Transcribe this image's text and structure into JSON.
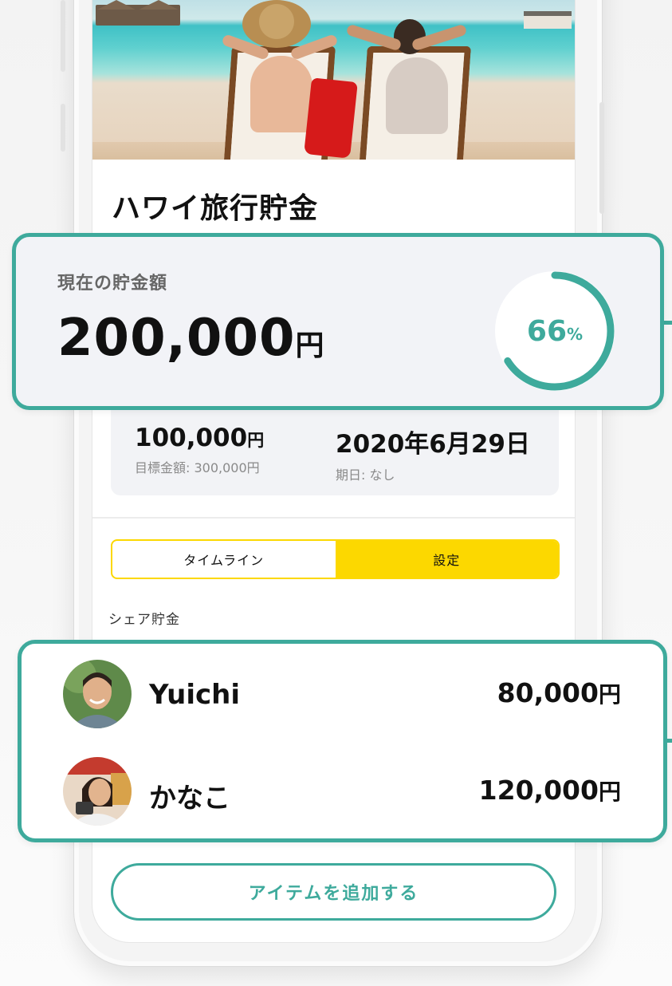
{
  "goal": {
    "title": "ハワイ旅行貯金"
  },
  "savings": {
    "label": "現在の貯金額",
    "amount": "200,000",
    "unit": "円",
    "progress_value": "66",
    "progress_unit": "%",
    "progress_fraction": 0.66
  },
  "stats": {
    "remaining": {
      "value": "100,000",
      "unit": "円",
      "sub": "目標金額: 300,000円"
    },
    "date": {
      "value": "2020年6月29日",
      "sub": "期日: なし"
    }
  },
  "tabs": [
    {
      "label": "タイムライン",
      "active": false
    },
    {
      "label": "設定",
      "active": true
    }
  ],
  "share": {
    "label": "シェア貯金",
    "members": [
      {
        "name": "Yuichi",
        "amount": "80,000",
        "unit": "円"
      },
      {
        "name": "かなこ",
        "amount": "120,000",
        "unit": "円"
      }
    ]
  },
  "add_button": "アイテムを追加する",
  "colors": {
    "accent": "#3eaa9c",
    "tab_active": "#fcd800",
    "panel": "#f2f3f6"
  }
}
